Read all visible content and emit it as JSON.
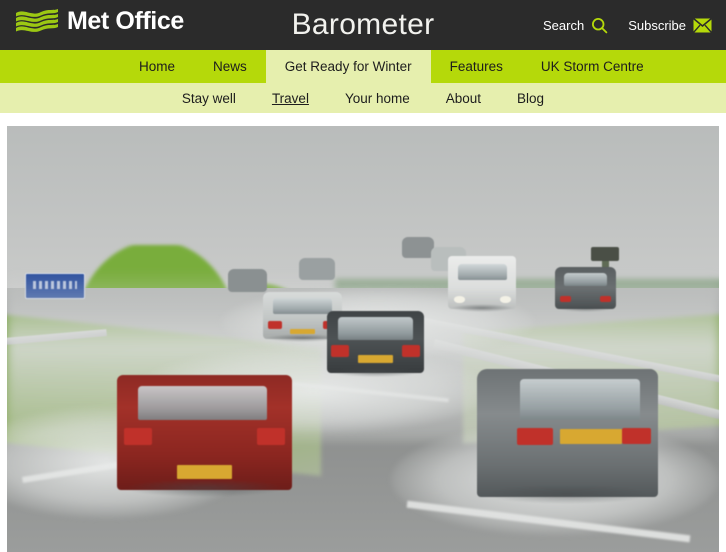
{
  "header": {
    "logo_text": "Met Office",
    "logo_icon": "met-office-wave-logo",
    "site_title": "Barometer",
    "actions": [
      {
        "label": "Search",
        "icon": "search-icon"
      },
      {
        "label": "Subscribe",
        "icon": "envelope-icon"
      }
    ]
  },
  "main_nav": {
    "items": [
      {
        "label": "Home",
        "active": false
      },
      {
        "label": "News",
        "active": false
      },
      {
        "label": "Get Ready for Winter",
        "active": true
      },
      {
        "label": "Features",
        "active": false
      },
      {
        "label": "UK Storm Centre",
        "active": false
      }
    ]
  },
  "sub_nav": {
    "items": [
      {
        "label": "Stay well",
        "current": false
      },
      {
        "label": "Travel",
        "current": true
      },
      {
        "label": "Your home",
        "current": false
      },
      {
        "label": "About",
        "current": false
      },
      {
        "label": "Blog",
        "current": false
      }
    ]
  },
  "hero": {
    "alt": "Heavy rain and spray on a UK motorway with traffic",
    "scene": "motorway-in-heavy-rain"
  },
  "colors": {
    "header_background": "#2b2b2b",
    "nav_green": "#b5d90a",
    "subnav_green": "#e6efae",
    "accent_green": "#b5d90a",
    "header_text": "#ffffff",
    "nav_text": "#1d1d1d"
  }
}
